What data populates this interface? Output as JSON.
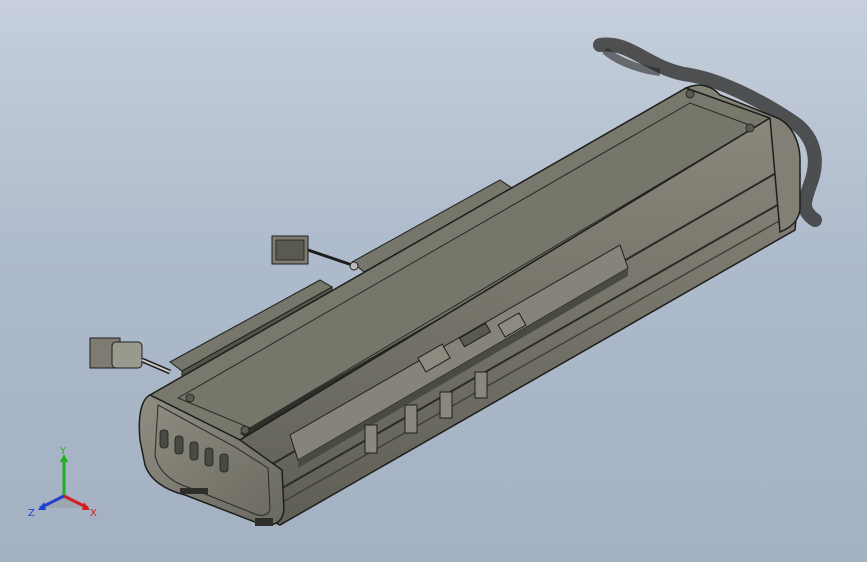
{
  "viewport": {
    "background_top": "#c6cfdb",
    "background_bottom": "#a3b1c3",
    "model_colors": {
      "body": "#7c7a6e",
      "top_plate": "#77776a",
      "edge": "#1e1e1c",
      "dark": "#3a3a36"
    }
  },
  "triad": {
    "x_label": "X",
    "y_label": "Y",
    "z_label": "Z",
    "x_color": "#d02020",
    "y_color": "#20b020",
    "z_color": "#2040d0"
  },
  "icons": {
    "triad": "orientation-triad-icon",
    "connector": "cable-connector-icon"
  }
}
